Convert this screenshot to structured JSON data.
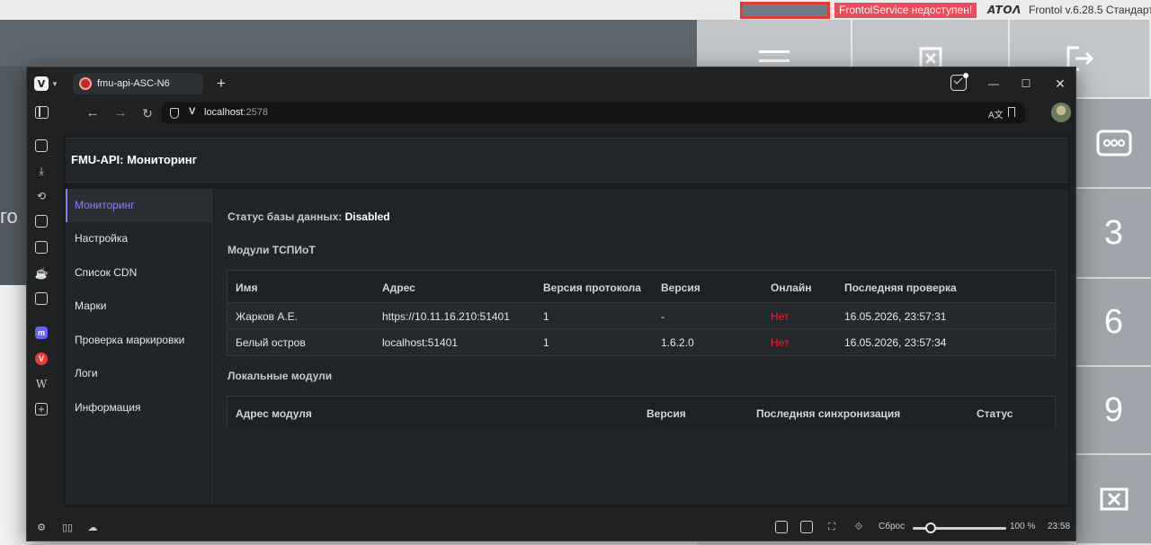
{
  "background_app": {
    "error_badge": "FrontolService недоступен!",
    "atol_logo": "ATOΛ",
    "version_text": "Frontol v.6.28.5 Стандарт",
    "left_partial_text": "го",
    "keypad": {
      "more": "•••",
      "k3": "3",
      "k6": "6",
      "k9": "9"
    }
  },
  "browser": {
    "tab_title": "fmu-api-ASC-N6",
    "new_tab": "+",
    "url_host": "localhost",
    "url_port": ":2578",
    "site_badge": "V",
    "zoom_reset_label": "Сброс",
    "zoom_value": "100 %",
    "clock": "23:58",
    "zoom_level_percent": 100
  },
  "page": {
    "title": "FMU-API: Мониторинг",
    "nav": [
      {
        "label": "Мониторинг",
        "active": true
      },
      {
        "label": "Настройка"
      },
      {
        "label": "Список CDN"
      },
      {
        "label": "Марки"
      },
      {
        "label": "Проверка маркировки"
      },
      {
        "label": "Логи"
      },
      {
        "label": "Информация"
      }
    ],
    "db_status_label": "Статус базы данных:",
    "db_status_value": "Disabled",
    "tspiot_section_title": "Модули ТСПИоТ",
    "tspiot_table": {
      "headers": [
        "Имя",
        "Адрес",
        "Версия протокола",
        "Версия",
        "Онлайн",
        "Последняя проверка"
      ],
      "rows": [
        [
          "Жарков А.Е.",
          "https://10.11.16.210:51401",
          "1",
          "-",
          "Нет",
          "16.05.2026, 23:57:31"
        ],
        [
          "Белый остров",
          "localhost:51401",
          "1",
          "1.6.2.0",
          "Нет",
          "16.05.2026, 23:57:34"
        ]
      ]
    },
    "local_section_title": "Локальные модули",
    "local_table": {
      "headers": [
        "Адрес модуля",
        "Версия",
        "Последняя синхронизация",
        "Статус"
      ]
    }
  },
  "colors": {
    "accent": "#8d7cff",
    "offline": "#e8242b",
    "error_badge": "#ee4a5a"
  }
}
